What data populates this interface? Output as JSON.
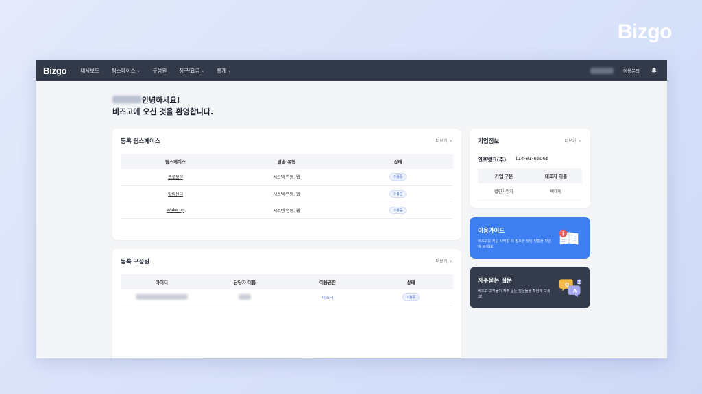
{
  "brand": "Bizgo",
  "nav": {
    "logo": "Bizgo",
    "items": [
      {
        "label": "대시보드",
        "has_dropdown": false
      },
      {
        "label": "팀스페이스",
        "has_dropdown": true
      },
      {
        "label": "구성원",
        "has_dropdown": false
      },
      {
        "label": "청구/요금",
        "has_dropdown": true
      },
      {
        "label": "통계",
        "has_dropdown": true
      }
    ],
    "inquiry": "이용문의"
  },
  "greeting": {
    "line1": "안녕하세요!",
    "line2": "비즈고에 오신 것을 환영합니다."
  },
  "teamspaces": {
    "title": "등록 팀스페이스",
    "more": "더보기",
    "columns": [
      "팀스페이스",
      "발송 유형",
      "상태"
    ],
    "rows": [
      {
        "name": "프로모션",
        "type": "시스템 연동, 웹",
        "status": "이용중"
      },
      {
        "name": "알림센터",
        "type": "시스템 연동, 웹",
        "status": "이용중"
      },
      {
        "name": "Wake up",
        "type": "시스템 연동, 웹",
        "status": "이용중"
      }
    ]
  },
  "members": {
    "title": "등록 구성원",
    "more": "더보기",
    "columns": [
      "아이디",
      "담당자 이름",
      "이용권한",
      "상태"
    ],
    "rows": [
      {
        "role": "마스터",
        "status": "이용중"
      }
    ]
  },
  "company": {
    "title": "기업정보",
    "more": "더보기",
    "name": "인포뱅크(주)",
    "number": "114-81-66066",
    "columns": [
      "기업 구분",
      "대표자 이름"
    ],
    "row": {
      "type": "법인사업자",
      "ceo": "박대형"
    }
  },
  "guide": {
    "title": "이용가이드",
    "desc": "비즈고를 처음 시작할 때 필요한 셋팅 방법을 확인해 보세요!",
    "color": "#3d7ef0"
  },
  "faq": {
    "title": "자주묻는 질문",
    "desc": "비즈고 고객들이 자주 묻는 질문들을 확인해 보세요!",
    "color": "#343c4c"
  },
  "colors": {
    "nav_bg": "#323a4a",
    "accent": "#4a6fd8"
  }
}
